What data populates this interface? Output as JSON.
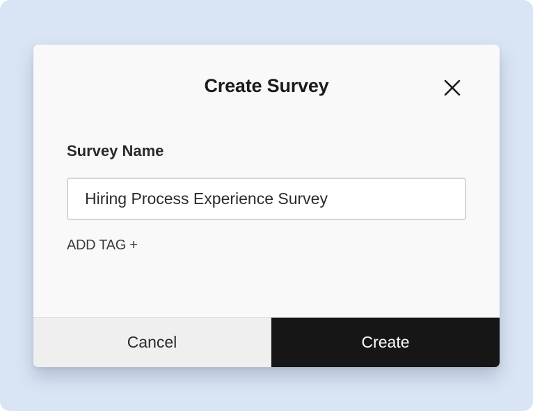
{
  "dialog": {
    "title": "Create Survey",
    "close_icon": "close-icon"
  },
  "form": {
    "survey_name_label": "Survey Name",
    "survey_name_value": "Hiring Process Experience Survey",
    "add_tag_label": "ADD TAG +"
  },
  "footer": {
    "cancel_label": "Cancel",
    "create_label": "Create"
  },
  "colors": {
    "backdrop": "#d9e5f5",
    "dialog_bg": "#f9f9f9",
    "primary_button": "#161616",
    "secondary_button": "#efefef"
  }
}
